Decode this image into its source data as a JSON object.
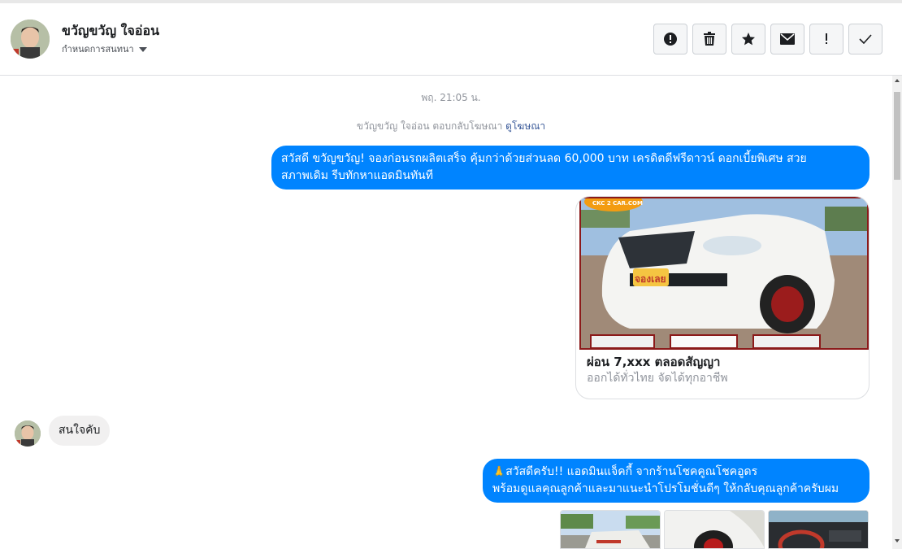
{
  "header": {
    "contact_name": "ขวัญขวัญ ใจอ่อน",
    "assign_label": "กำหนดการสนทนา",
    "actions": [
      {
        "icon": "exclamation-circle-icon"
      },
      {
        "icon": "trash-icon"
      },
      {
        "icon": "star-icon"
      },
      {
        "icon": "envelope-icon"
      },
      {
        "icon": "exclamation-icon",
        "label": "!"
      },
      {
        "icon": "check-icon"
      }
    ]
  },
  "thread": {
    "timestamp": "พฤ. 21:05 น.",
    "system_message": "ขวัญขวัญ ใจอ่อน ตอบกลับโฆษณา",
    "system_link": "ดูโฆษณา",
    "msg1_line1": "สวัสดี ขวัญขวัญ! จองก่อนรถผลิตเสร็จ คุ้มกว่าด้วยส่วนลด 60,000 บาท เครดิตดีฟรีดาวน์ ดอกเบี้ยพิเศษ สวย",
    "msg1_line2": "สภาพเดิม รีบทักหาแอดมินทันที",
    "card": {
      "logo_text": "CKC 2 CAR.COM",
      "sticker_text": "จองเลย",
      "title": "ผ่อน 7,xxx ตลอดสัญญา",
      "subtitle": "ออกได้ทั่วไทย จัดได้ทุกอาชีพ"
    },
    "reply": "สนใจคับ",
    "msg2_emoji": "🙏",
    "msg2_line1": "สวัสดีครับ!! แอดมินแจ็คกี้ จากร้านโชคคูณโชคอูดร",
    "msg2_line2": "พร้อมดูแลคุณลูกค้าและมาแนะนำโปรโมชั่นดีๆ ให้กลับคุณลูกค้าครับผม"
  },
  "colors": {
    "outgoing": "#0084ff",
    "incoming": "#f1f0f0",
    "link": "#385898",
    "muted": "#90949c"
  }
}
